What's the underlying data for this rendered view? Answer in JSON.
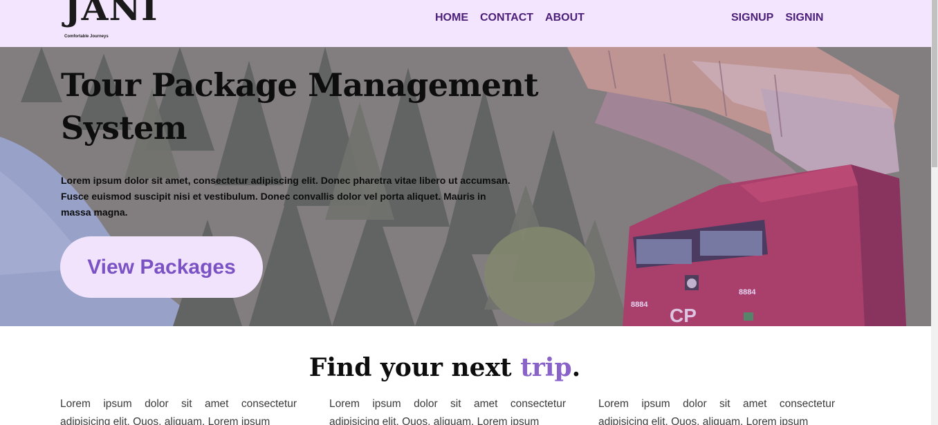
{
  "brand": {
    "name": "JANI",
    "tagline": "Comfortable Journeys"
  },
  "nav": {
    "links": [
      "HOME",
      "CONTACT",
      "ABOUT"
    ],
    "auth": [
      "SIGNUP",
      "SIGNIN"
    ]
  },
  "hero": {
    "title": "Tour Package Management System",
    "text": "Lorem ipsum dolor sit amet, consectetur adipiscing elit. Donec pharetra vitae libero ut accumsan. Fusce euismod suscipit nisi et vestibulum. Donec convallis dolor vel porta aliquet. Mauris in massa magna.",
    "button": "View Packages",
    "train_numbers": [
      "8884",
      "8884"
    ],
    "train_logo": "CP"
  },
  "section": {
    "title_pre": "Find your next ",
    "title_accent": "trip",
    "title_post": ".",
    "columns": [
      "Lorem ipsum dolor sit amet consectetur adipisicing elit. Quos, aliquam. Lorem ipsum",
      "Lorem ipsum dolor sit amet consectetur adipisicing elit. Quos, aliquam. Lorem ipsum",
      "Lorem ipsum dolor sit amet consectetur adipisicing elit. Quos, aliquam. Lorem ipsum"
    ]
  },
  "colors": {
    "nav_bg": "#f3e5fd",
    "nav_text": "#4b1f7a",
    "accent": "#8a63c9",
    "button_bg": "#f1e3fc",
    "button_text": "#7b52c4"
  }
}
